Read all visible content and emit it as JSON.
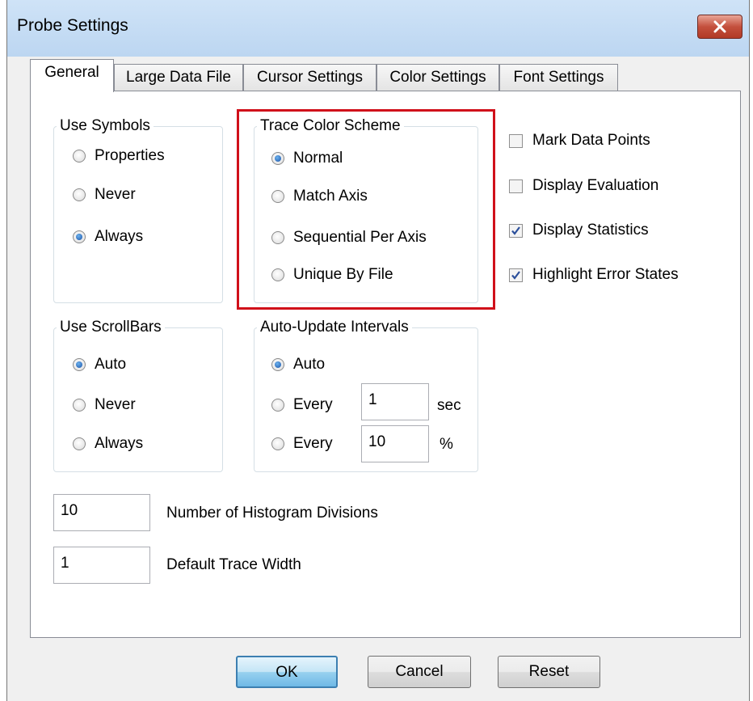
{
  "window": {
    "title": "Probe Settings"
  },
  "tabs": [
    "General",
    "Large Data File",
    "Cursor Settings",
    "Color Settings",
    "Font Settings"
  ],
  "active_tab": "General",
  "use_symbols": {
    "legend": "Use Symbols",
    "options": [
      "Properties",
      "Never",
      "Always"
    ],
    "selected": "Always"
  },
  "trace_color_scheme": {
    "legend": "Trace Color Scheme",
    "options": [
      "Normal",
      "Match Axis",
      "Sequential Per Axis",
      "Unique By File"
    ],
    "selected": "Normal"
  },
  "checkboxes": [
    {
      "label": "Mark Data Points",
      "checked": false
    },
    {
      "label": "Display Evaluation",
      "checked": false
    },
    {
      "label": "Display Statistics",
      "checked": true
    },
    {
      "label": "Highlight Error States",
      "checked": true
    }
  ],
  "use_scrollbars": {
    "legend": "Use ScrollBars",
    "options": [
      "Auto",
      "Never",
      "Always"
    ],
    "selected": "Auto"
  },
  "auto_update": {
    "legend": "Auto-Update Intervals",
    "auto_label": "Auto",
    "every_label": "Every",
    "sec_value": "1",
    "sec_unit": "sec",
    "pct_value": "10",
    "pct_unit": "%",
    "selected": "Auto"
  },
  "histogram": {
    "value": "10",
    "label": "Number of Histogram Divisions"
  },
  "trace_width": {
    "value": "1",
    "label": "Default Trace Width"
  },
  "buttons": {
    "ok": "OK",
    "cancel": "Cancel",
    "reset": "Reset"
  },
  "colors": {
    "highlight_box": "#d0101a",
    "titlebar": "#c5dcf4",
    "close_button": "#c4503d"
  }
}
